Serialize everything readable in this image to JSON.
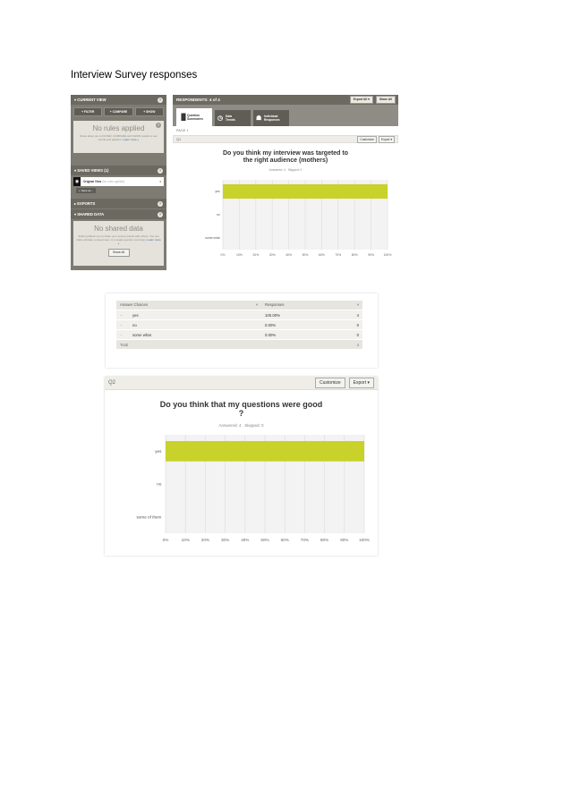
{
  "doc": {
    "title": "Interview Survey responses"
  },
  "shot1": {
    "sidebar": {
      "current_view": "CURRENT VIEW",
      "filter": "+ FILTER",
      "compare": "+ COMPARE",
      "show": "+ SHOW",
      "no_rules": "No rules applied",
      "no_rules_desc": "Rules allow you to FILTER, COMPARE and SHOW results to see trends and patterns.",
      "learn_more": "Learn more »",
      "saved_views": "SAVED VIEWS",
      "saved_views_count": "(1)",
      "original_view": "Original View",
      "no_rules_small": "(No rules applied)",
      "save_as": "+ Save as...",
      "exports": "EXPORTS",
      "shared_data": "SHARED DATA",
      "no_shared": "No shared data",
      "shared_desc": "Sharing allows you to share your survey results with others. You can share all data, a saved view, or a single question summary.",
      "share_all": "Share All",
      "q_mark": "?"
    },
    "top": {
      "respondents": "RESPONDENTS: 4 of 4",
      "export_all": "Export All ▾",
      "share_all": "Share All"
    },
    "tabs": [
      {
        "icon": "▐▌",
        "label1": "Question",
        "label2": "Summaries"
      },
      {
        "icon": "◷",
        "label1": "Data",
        "label2": "Trends"
      },
      {
        "icon": "☗",
        "label1": "Individual",
        "label2": "Responses"
      }
    ],
    "page_label": "PAGE 1",
    "question_id": "Q1",
    "customize": "Customize",
    "export": "Export ▾",
    "question_line1": "Do you think my interview was targeted to",
    "question_line2": "the right audience (mothers)",
    "answered": "Answered: 4",
    "skipped": "Skipped: 0",
    "chart_data": {
      "type": "bar",
      "orientation": "horizontal",
      "categories": [
        "yes",
        "no",
        "some what"
      ],
      "values": [
        100,
        0,
        0
      ],
      "xlim": [
        0,
        100
      ],
      "ticks": [
        "0%",
        "10%",
        "20%",
        "30%",
        "40%",
        "50%",
        "60%",
        "70%",
        "80%",
        "90%",
        "100%"
      ],
      "bar_color": "#c8d22a",
      "grid": true
    }
  },
  "table": {
    "col_choices": "Answer Choices",
    "col_responses": "Responses",
    "rows": [
      {
        "choice": "yes",
        "pct": "100.00%",
        "count": "4"
      },
      {
        "choice": "no",
        "pct": "0.00%",
        "count": "0"
      },
      {
        "choice": "some what",
        "pct": "0.00%",
        "count": "0"
      }
    ],
    "total_label": "Total",
    "total_count": "4",
    "bullet": "–",
    "sort_mark": "▾"
  },
  "shot3": {
    "question_id": "Q2",
    "customize": "Customize",
    "export": "Export ▾",
    "question_line1": "Do you think that my questions were good",
    "question_line2": "?",
    "answered": "Answered: 4",
    "skipped": "Skipped: 0",
    "chart_data": {
      "type": "bar",
      "orientation": "horizontal",
      "categories": [
        "yes",
        "no",
        "some of them"
      ],
      "values": [
        100,
        0,
        0
      ],
      "xlim": [
        0,
        100
      ],
      "ticks": [
        "0%",
        "10%",
        "20%",
        "30%",
        "40%",
        "50%",
        "60%",
        "70%",
        "80%",
        "90%",
        "100%"
      ],
      "bar_color": "#c8d22a",
      "grid": true
    }
  }
}
